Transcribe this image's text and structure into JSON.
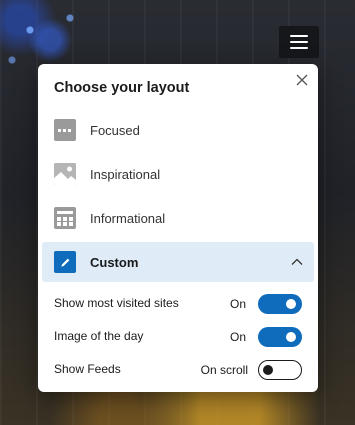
{
  "panel": {
    "title": "Choose your layout",
    "options": [
      {
        "label": "Focused",
        "icon": "focused-layout-icon"
      },
      {
        "label": "Inspirational",
        "icon": "image-layout-icon"
      },
      {
        "label": "Informational",
        "icon": "info-layout-icon"
      },
      {
        "label": "Custom",
        "icon": "pencil-icon",
        "selected": true,
        "expanded": true
      }
    ],
    "settings": [
      {
        "label": "Show most visited sites",
        "value": "On",
        "toggle": "on"
      },
      {
        "label": "Image of the day",
        "value": "On",
        "toggle": "on"
      },
      {
        "label": "Show Feeds",
        "value": "On scroll",
        "toggle": "off"
      }
    ]
  },
  "colors": {
    "accent": "#0f6cbd",
    "selected_bg": "#dfecf8",
    "icon_gray": "#9a9a9a"
  }
}
